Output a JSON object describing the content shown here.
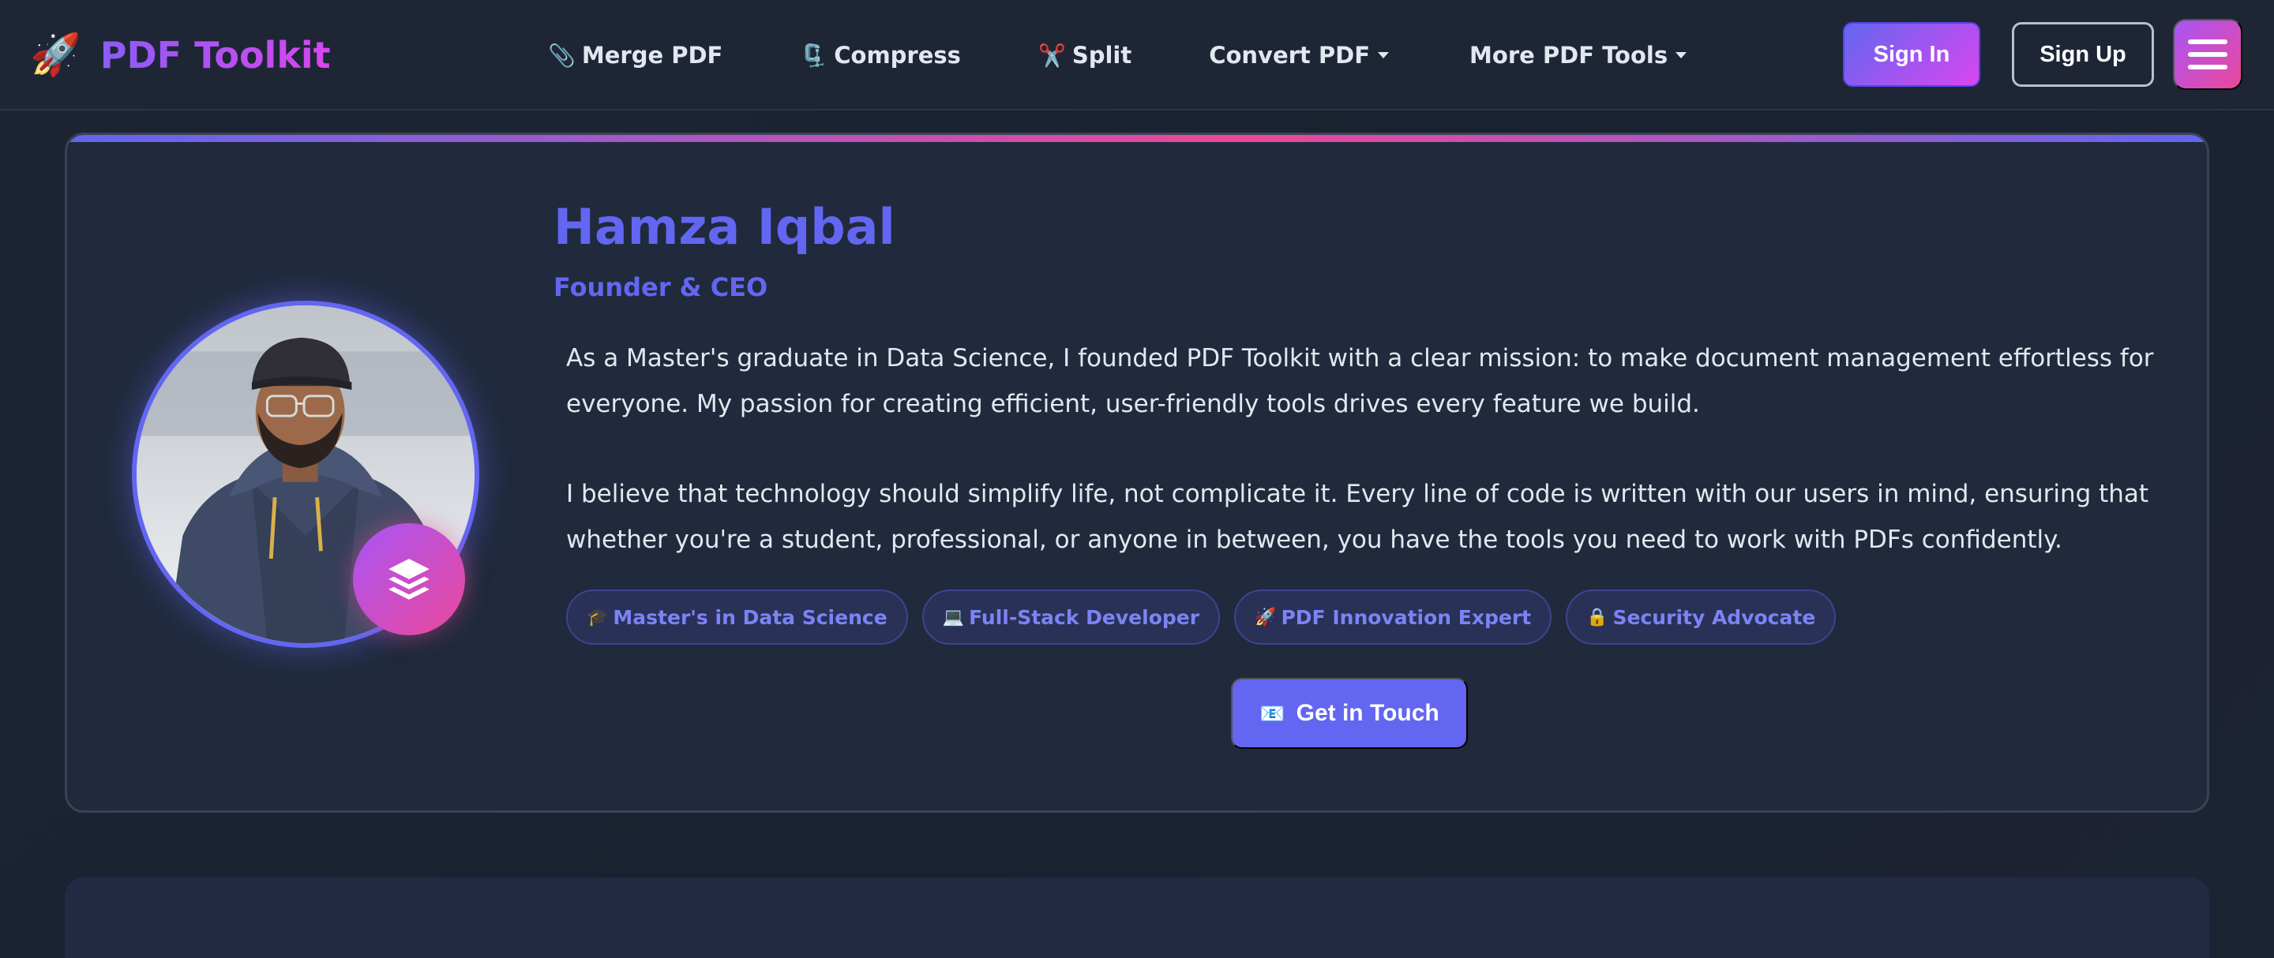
{
  "nav": {
    "brand": {
      "icon": "🚀",
      "name": "PDF Toolkit"
    },
    "links": [
      {
        "icon": "📎",
        "label": "Merge PDF",
        "dropdown": false
      },
      {
        "icon": "🗜️",
        "label": "Compress",
        "dropdown": false
      },
      {
        "icon": "✂️",
        "label": "Split",
        "dropdown": false
      },
      {
        "icon": "",
        "label": "Convert PDF",
        "dropdown": true
      },
      {
        "icon": "",
        "label": "More PDF Tools",
        "dropdown": true
      }
    ],
    "signin_label": "Sign In",
    "signup_label": "Sign Up",
    "menu_icon": "hamburger-icon"
  },
  "profile": {
    "name": "Hamza Iqbal",
    "role": "Founder & CEO",
    "bio": [
      "As a Master's graduate in Data Science, I founded PDF Toolkit with a clear mission: to make document management effortless for everyone. My passion for creating efficient, user-friendly tools drives every feature we build.",
      "I believe that technology should simplify life, not complicate it. Every line of code is written with our users in mind, ensuring that whether you're a student, professional, or anyone in between, you have the tools you need to work with PDFs confidently."
    ],
    "tags": [
      {
        "icon": "🎓",
        "label": "Master's in Data Science"
      },
      {
        "icon": "💻",
        "label": "Full-Stack Developer"
      },
      {
        "icon": "🚀",
        "label": "PDF Innovation Expert"
      },
      {
        "icon": "🔒",
        "label": "Security Advocate"
      }
    ],
    "cta": {
      "icon": "📧",
      "label": "Get in Touch"
    },
    "badge_icon": "layers-icon"
  },
  "colors": {
    "accent": "#6366f1",
    "accent_pink": "#ec4899",
    "background": "#1b2232",
    "card": "#202a3c"
  }
}
